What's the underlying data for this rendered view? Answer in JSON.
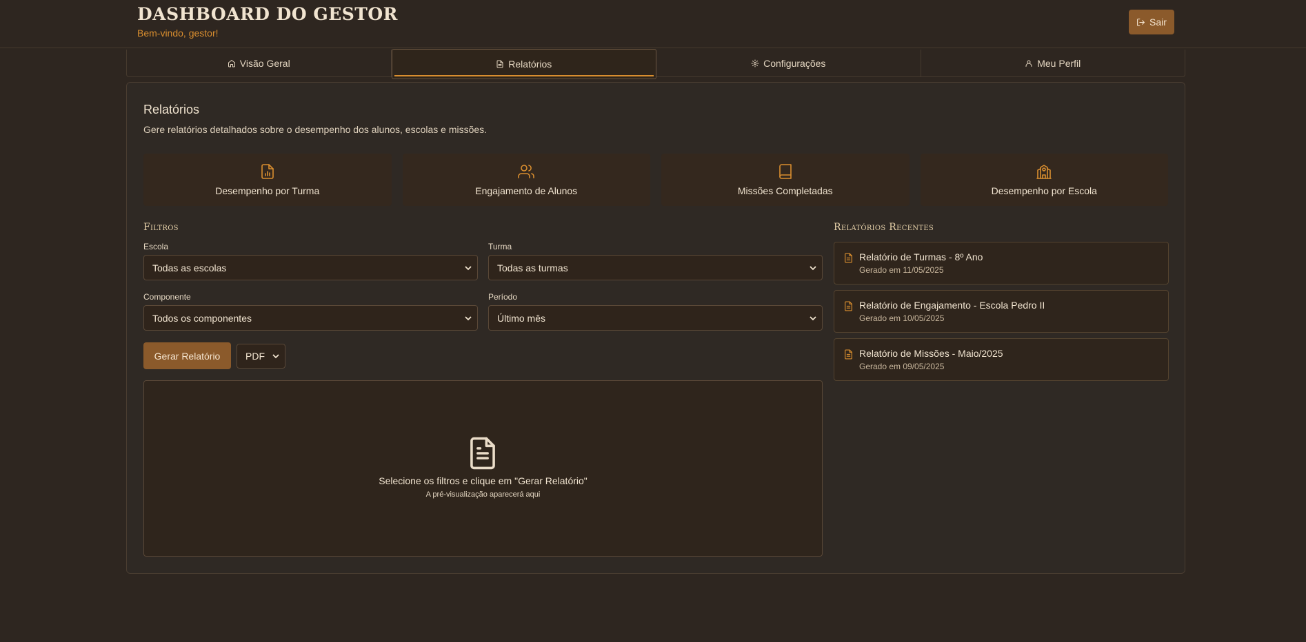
{
  "header": {
    "title": "DASHBOARD DO GESTOR",
    "welcome": "Bem-vindo, gestor!",
    "logout_label": "Sair"
  },
  "tabs": [
    {
      "label": "Visão Geral",
      "icon": "home-icon"
    },
    {
      "label": "Relatórios",
      "icon": "file-icon",
      "active": true
    },
    {
      "label": "Configurações",
      "icon": "gear-icon"
    },
    {
      "label": "Meu Perfil",
      "icon": "user-icon"
    }
  ],
  "reports": {
    "title": "Relatórios",
    "description": "Gere relatórios detalhados sobre o desempenho dos alunos, escolas e missões.",
    "types": [
      {
        "label": "Desempenho por Turma",
        "icon": "file-chart-icon"
      },
      {
        "label": "Engajamento de Alunos",
        "icon": "users-icon"
      },
      {
        "label": "Missões Completadas",
        "icon": "book-icon"
      },
      {
        "label": "Desempenho por Escola",
        "icon": "school-icon"
      }
    ]
  },
  "filters": {
    "title": "Filtros",
    "school": {
      "label": "Escola",
      "value": "Todas as escolas"
    },
    "class": {
      "label": "Turma",
      "value": "Todas as turmas"
    },
    "component": {
      "label": "Componente",
      "value": "Todos os componentes"
    },
    "period": {
      "label": "Período",
      "value": "Último mês"
    },
    "generate_label": "Gerar Relatório",
    "format": "PDF"
  },
  "preview": {
    "message": "Selecione os filtros e clique em \"Gerar Relatório\"",
    "hint": "A pré-visualização aparecerá aqui"
  },
  "recent": {
    "title": "Relatórios Recentes",
    "items": [
      {
        "title": "Relatório de Turmas - 8º Ano",
        "date": "Gerado em 11/05/2025"
      },
      {
        "title": "Relatório de Engajamento - Escola Pedro II",
        "date": "Gerado em 10/05/2025"
      },
      {
        "title": "Relatório de Missões - Maio/2025",
        "date": "Gerado em 09/05/2025"
      }
    ]
  },
  "colors": {
    "accent": "#d98e2f",
    "button": "#8b5a2b",
    "background": "#2e2620"
  }
}
